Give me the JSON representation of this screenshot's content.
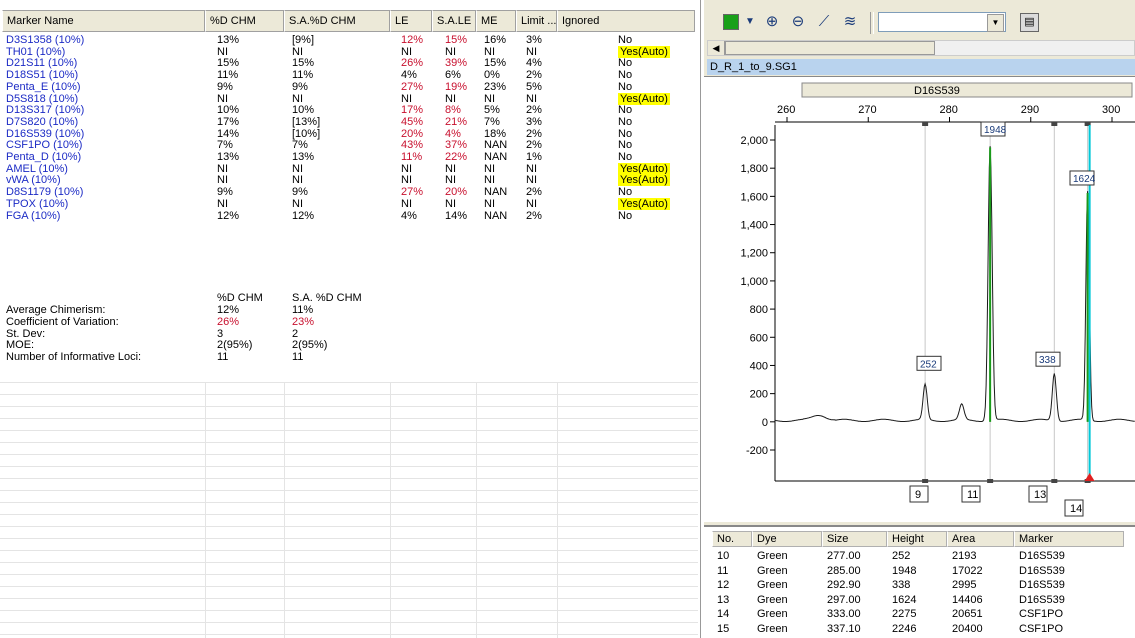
{
  "markers_table": {
    "columns": [
      "Marker Name",
      "%D CHM",
      "S.A.%D CHM",
      "LE",
      "S.A.LE",
      "ME",
      "Limit ...",
      "Ignored"
    ],
    "rows": [
      {
        "name": "D3S1358 (10%)",
        "dchm": "13%",
        "sadchm": "[9%]",
        "le": "12%",
        "sale": "15%",
        "me": "16%",
        "limit": "3%",
        "ignored": "No",
        "le_red": true,
        "yes": false
      },
      {
        "name": "TH01 (10%)",
        "dchm": "NI",
        "sadchm": "NI",
        "le": "NI",
        "sale": "NI",
        "me": "NI",
        "limit": "NI",
        "ignored": "Yes(Auto)",
        "le_red": false,
        "yes": true
      },
      {
        "name": "D21S11 (10%)",
        "dchm": "15%",
        "sadchm": "15%",
        "le": "26%",
        "sale": "39%",
        "me": "15%",
        "limit": "4%",
        "ignored": "No",
        "le_red": true,
        "yes": false
      },
      {
        "name": "D18S51 (10%)",
        "dchm": "11%",
        "sadchm": "11%",
        "le": "4%",
        "sale": "6%",
        "me": "0%",
        "limit": "2%",
        "ignored": "No",
        "le_red": false,
        "yes": false
      },
      {
        "name": "Penta_E (10%)",
        "dchm": "9%",
        "sadchm": "9%",
        "le": "27%",
        "sale": "19%",
        "me": "23%",
        "limit": "5%",
        "ignored": "No",
        "le_red": true,
        "yes": false
      },
      {
        "name": "D5S818 (10%)",
        "dchm": "NI",
        "sadchm": "NI",
        "le": "NI",
        "sale": "NI",
        "me": "NI",
        "limit": "NI",
        "ignored": "Yes(Auto)",
        "le_red": false,
        "yes": true
      },
      {
        "name": "D13S317 (10%)",
        "dchm": "10%",
        "sadchm": "10%",
        "le": "17%",
        "sale": "8%",
        "me": "5%",
        "limit": "2%",
        "ignored": "No",
        "le_red": true,
        "yes": false
      },
      {
        "name": "D7S820 (10%)",
        "dchm": "17%",
        "sadchm": "[13%]",
        "le": "45%",
        "sale": "21%",
        "me": "7%",
        "limit": "3%",
        "ignored": "No",
        "le_red": true,
        "yes": false
      },
      {
        "name": "D16S539 (10%)",
        "dchm": "14%",
        "sadchm": "[10%]",
        "le": "20%",
        "sale": "4%",
        "me": "18%",
        "limit": "2%",
        "ignored": "No",
        "le_red": true,
        "yes": false
      },
      {
        "name": "CSF1PO (10%)",
        "dchm": "7%",
        "sadchm": "7%",
        "le": "43%",
        "sale": "37%",
        "me": "NAN",
        "limit": "2%",
        "ignored": "No",
        "le_red": true,
        "yes": false
      },
      {
        "name": "Penta_D (10%)",
        "dchm": "13%",
        "sadchm": "13%",
        "le": "11%",
        "sale": "22%",
        "me": "NAN",
        "limit": "1%",
        "ignored": "No",
        "le_red": true,
        "yes": false
      },
      {
        "name": "AMEL (10%)",
        "dchm": "NI",
        "sadchm": "NI",
        "le": "NI",
        "sale": "NI",
        "me": "NI",
        "limit": "NI",
        "ignored": "Yes(Auto)",
        "le_red": false,
        "yes": true
      },
      {
        "name": "vWA (10%)",
        "dchm": "NI",
        "sadchm": "NI",
        "le": "NI",
        "sale": "NI",
        "me": "NI",
        "limit": "NI",
        "ignored": "Yes(Auto)",
        "le_red": false,
        "yes": true
      },
      {
        "name": "D8S1179 (10%)",
        "dchm": "9%",
        "sadchm": "9%",
        "le": "27%",
        "sale": "20%",
        "me": "NAN",
        "limit": "2%",
        "ignored": "No",
        "le_red": true,
        "yes": false
      },
      {
        "name": "TPOX (10%)",
        "dchm": "NI",
        "sadchm": "NI",
        "le": "NI",
        "sale": "NI",
        "me": "NI",
        "limit": "NI",
        "ignored": "Yes(Auto)",
        "le_red": false,
        "yes": true
      },
      {
        "name": "FGA (10%)",
        "dchm": "12%",
        "sadchm": "12%",
        "le": "4%",
        "sale": "14%",
        "me": "NAN",
        "limit": "2%",
        "ignored": "No",
        "le_red": false,
        "yes": false
      }
    ]
  },
  "summary": {
    "col1": "%D CHM",
    "col2": "S.A. %D CHM",
    "rows": [
      {
        "label": "Average Chimerism:",
        "v1": "12%",
        "v2": "11%",
        "red": false
      },
      {
        "label": "Coefficient of Variation:",
        "v1": "26%",
        "v2": "23%",
        "red": true
      },
      {
        "label": "St. Dev:",
        "v1": "3",
        "v2": "2",
        "red": false
      },
      {
        "label": "MOE:",
        "v1": "2(95%)",
        "v2": "2(95%)",
        "red": false
      },
      {
        "label": "Number of Informative Loci:",
        "v1": "11",
        "v2": "11",
        "red": false
      }
    ]
  },
  "toolbar": {
    "color_swatch": "#19a019",
    "icons": [
      "dropdown-arrow-icon",
      "zoom-in-icon",
      "zoom-out-icon",
      "edit-graph-icon",
      "graph-settings-icon",
      "print-icon"
    ],
    "combo_value": ""
  },
  "electropherogram": {
    "sample_name": "D_R_1_to_9.SG1",
    "marker_label": "D16S539",
    "x_ticks": [
      260,
      270,
      280,
      290,
      300
    ],
    "y_ticks": [
      "2,000",
      "1,800",
      "1,600",
      "1,400",
      "1,200",
      "1,000",
      "800",
      "600",
      "400",
      "200",
      "0",
      "-200"
    ],
    "peak_labels": [
      "252",
      "1948",
      "338",
      "1624"
    ],
    "allele_labels": [
      "9",
      "11",
      "13",
      "14"
    ],
    "trace_color": "#1a1a1a",
    "marker_line_color": "#00c8d8"
  },
  "peaks_table": {
    "columns": [
      "No.",
      "Dye",
      "Size",
      "Height",
      "Area",
      "Marker"
    ],
    "rows": [
      [
        "10",
        "Green",
        "277.00",
        "252",
        "2193",
        "D16S539"
      ],
      [
        "11",
        "Green",
        "285.00",
        "1948",
        "17022",
        "D16S539"
      ],
      [
        "12",
        "Green",
        "292.90",
        "338",
        "2995",
        "D16S539"
      ],
      [
        "13",
        "Green",
        "297.00",
        "1624",
        "14406",
        "D16S539"
      ],
      [
        "14",
        "Green",
        "333.00",
        "2275",
        "20651",
        "CSF1PO"
      ],
      [
        "15",
        "Green",
        "337.10",
        "2246",
        "20400",
        "CSF1PO"
      ]
    ]
  }
}
